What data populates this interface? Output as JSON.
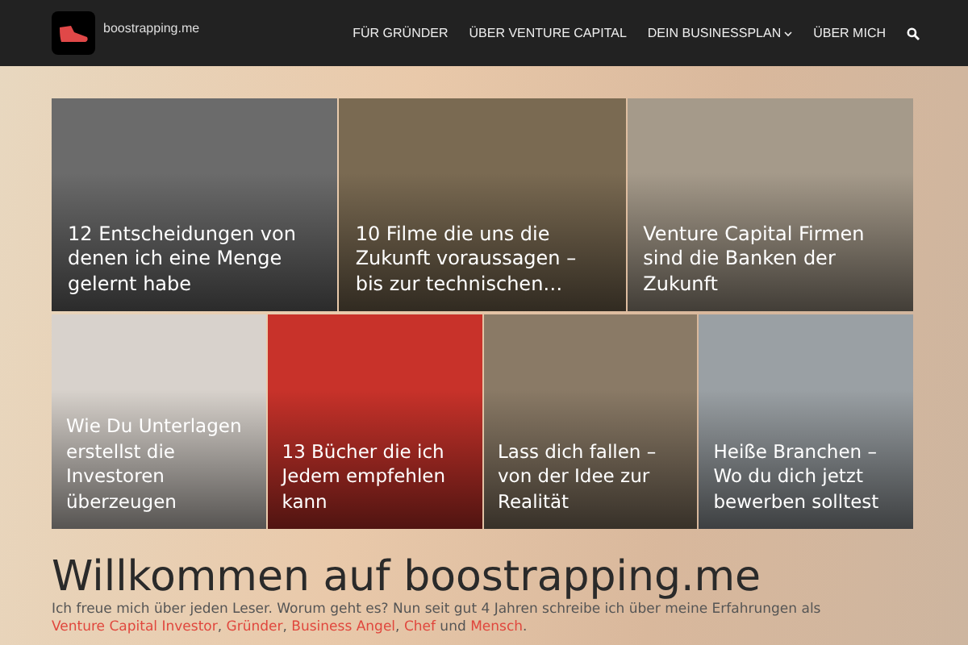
{
  "header": {
    "site_name": "boostrapping.me",
    "nav": [
      {
        "label": "FÜR GRÜNDER",
        "has_dropdown": false
      },
      {
        "label": "ÜBER VENTURE CAPITAL",
        "has_dropdown": false
      },
      {
        "label": "DEIN BUSINESSPLAN",
        "has_dropdown": true
      },
      {
        "label": "ÜBER MICH",
        "has_dropdown": false
      }
    ]
  },
  "featured_rows": [
    [
      {
        "title": "12 Entscheidungen von denen ich eine Menge gelernt habe",
        "color": "#6b6b6b"
      },
      {
        "title": "10 Filme die uns die Zukunft voraussagen – bis zur technischen…",
        "color": "#7a6a52"
      },
      {
        "title": "Venture Capital Firmen sind die Banken der Zukunft",
        "color": "#a59a8a"
      }
    ],
    [
      {
        "title": "Wie Du Unterlagen erstellst die Investoren überzeugen",
        "color": "#d8d2cc"
      },
      {
        "title": "13 Bücher die ich Jedem empfehlen kann",
        "color": "#c8322a"
      },
      {
        "title": "Lass dich fallen – von der Idee zur Realität",
        "color": "#8a7a66"
      },
      {
        "title": "Heiße Branchen – Wo du dich jetzt bewerben solltest",
        "color": "#9aa0a4"
      }
    ]
  ],
  "welcome": {
    "heading": "Willkommen auf boostrapping.me",
    "paragraph": [
      {
        "kind": "text",
        "text": "Ich freue mich über jeden Leser. Worum geht es? Nun seit gut 4 Jahren schreibe ich über meine Erfahrungen als "
      },
      {
        "kind": "link",
        "text": "Venture Capital Investor"
      },
      {
        "kind": "text",
        "text": ", "
      },
      {
        "kind": "link",
        "text": "Gründer"
      },
      {
        "kind": "text",
        "text": ", "
      },
      {
        "kind": "link",
        "text": "Business Angel"
      },
      {
        "kind": "text",
        "text": ", "
      },
      {
        "kind": "link",
        "text": "Chef"
      },
      {
        "kind": "text",
        "text": " und "
      },
      {
        "kind": "link",
        "text": "Mensch"
      },
      {
        "kind": "text",
        "text": "."
      }
    ]
  }
}
